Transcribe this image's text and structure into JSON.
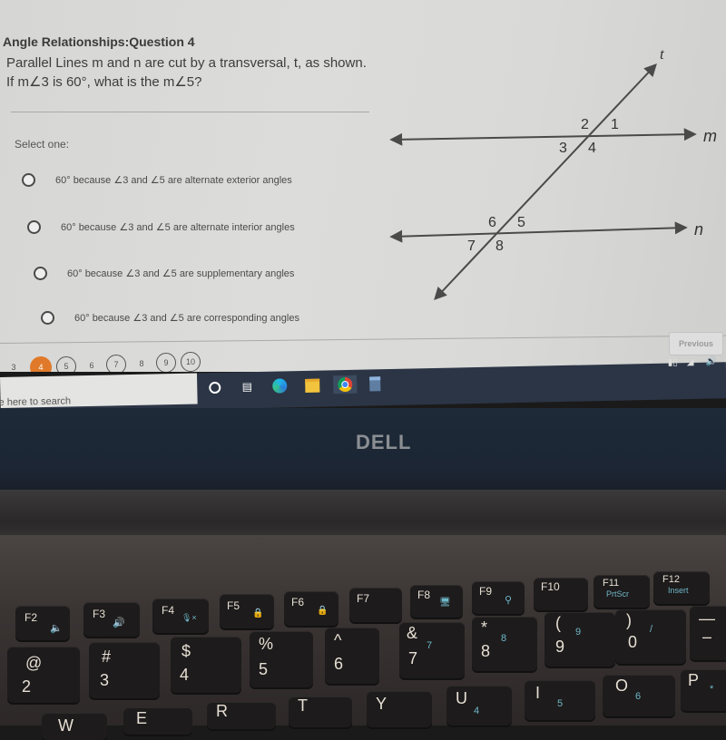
{
  "quiz": {
    "title": "Angle Relationships:Question 4",
    "question_line1": "Parallel Lines m and n are cut by a transversal, t, as shown.",
    "question_line2": "If m∠3 is 60°, what is the m∠5?",
    "select_prompt": "Select one:",
    "options": [
      {
        "label": "60° because ∠3 and ∠5 are alternate exterior angles",
        "selected": false
      },
      {
        "label": "60° because ∠3 and ∠5 are alternate interior angles",
        "selected": false
      },
      {
        "label": "60° because ∠3 and ∠5 are supplementary angles",
        "selected": false
      },
      {
        "label": "60° because ∠3 and ∠5 are corresponding angles",
        "selected": false
      }
    ],
    "previous_label": "Previous",
    "pager": [
      {
        "label": "3",
        "state": "plain"
      },
      {
        "label": "4",
        "state": "current"
      },
      {
        "label": "5",
        "state": "circled"
      },
      {
        "label": "6",
        "state": "plain"
      },
      {
        "label": "7",
        "state": "circled"
      },
      {
        "label": "8",
        "state": "plain"
      },
      {
        "label": "9",
        "state": "circled"
      },
      {
        "label": "10",
        "state": "circled"
      }
    ],
    "accent_color": "#e07a2a"
  },
  "diagram": {
    "transversal_label": "t",
    "line_m_label": "m",
    "line_n_label": "n",
    "angles_m": [
      "1",
      "2",
      "3",
      "4"
    ],
    "angles_n": [
      "5",
      "6",
      "7",
      "8"
    ]
  },
  "taskbar": {
    "search_placeholder": "e here to search",
    "apps": [
      "cortana-icon",
      "task-view-icon",
      "edge-icon",
      "file-explorer-icon",
      "chrome-icon",
      "calculator-icon"
    ],
    "tray": [
      "chevron-up-icon",
      "battery-icon",
      "wifi-icon",
      "volume-icon"
    ]
  },
  "laptop": {
    "brand": "DELL",
    "fkeys": [
      {
        "label": "F2",
        "sub": "🔈"
      },
      {
        "label": "F3",
        "sub": "🔊"
      },
      {
        "label": "F4",
        "sub": "🎙×"
      },
      {
        "label": "F5",
        "sub": "🔒"
      },
      {
        "label": "F6",
        "sub": "🔒"
      },
      {
        "label": "F7",
        "sub": ""
      },
      {
        "label": "F8",
        "sub": "🖥"
      },
      {
        "label": "F9",
        "sub": "⚲"
      },
      {
        "label": "F10",
        "sub": ""
      },
      {
        "label": "F11",
        "sub": "PrtScr"
      },
      {
        "label": "F12",
        "sub": "Insert"
      }
    ],
    "number_keys": [
      {
        "top": "@",
        "bottom": "2",
        "alt": ""
      },
      {
        "top": "#",
        "bottom": "3",
        "alt": ""
      },
      {
        "top": "$",
        "bottom": "4",
        "alt": ""
      },
      {
        "top": "%",
        "bottom": "5",
        "alt": ""
      },
      {
        "top": "^",
        "bottom": "6",
        "alt": ""
      },
      {
        "top": "&",
        "bottom": "7",
        "alt": "7"
      },
      {
        "top": "*",
        "bottom": "8",
        "alt": "8"
      },
      {
        "top": "(",
        "bottom": "9",
        "alt": "9"
      },
      {
        "top": ")",
        "bottom": "0",
        "alt": "/"
      },
      {
        "top": "—",
        "bottom": "–",
        "alt": ""
      }
    ],
    "letter_keys": [
      {
        "label": "W",
        "alt": ""
      },
      {
        "label": "E",
        "alt": ""
      },
      {
        "label": "R",
        "alt": ""
      },
      {
        "label": "T",
        "alt": ""
      },
      {
        "label": "Y",
        "alt": ""
      },
      {
        "label": "U",
        "alt": "4"
      },
      {
        "label": "I",
        "alt": "5"
      },
      {
        "label": "O",
        "alt": "6"
      },
      {
        "label": "P",
        "alt": "*"
      }
    ]
  }
}
